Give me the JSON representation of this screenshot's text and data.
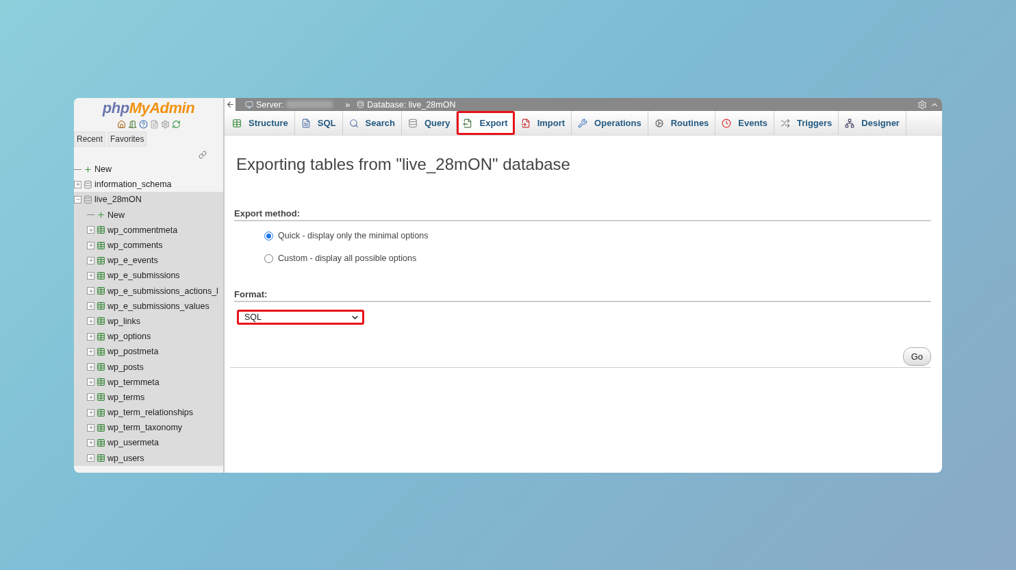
{
  "sidebar": {
    "logo": {
      "prefix": "php",
      "name": "MyAdmin"
    },
    "nav_buttons": [
      {
        "label": "Recent"
      },
      {
        "label": "Favorites"
      }
    ],
    "tree": [
      {
        "label": "New",
        "kind": "new"
      },
      {
        "label": "information_schema",
        "kind": "database",
        "expanded": false,
        "selected": false
      },
      {
        "label": "live_28mON",
        "kind": "database",
        "expanded": true,
        "selected": true,
        "children": [
          {
            "label": "New",
            "kind": "new"
          },
          {
            "label": "wp_commentmeta",
            "kind": "table",
            "expanded": false
          },
          {
            "label": "wp_comments",
            "kind": "table",
            "expanded": false
          },
          {
            "label": "wp_e_events",
            "kind": "table",
            "expanded": false
          },
          {
            "label": "wp_e_submissions",
            "kind": "table",
            "expanded": false
          },
          {
            "label": "wp_e_submissions_actions_l",
            "kind": "table",
            "expanded": false
          },
          {
            "label": "wp_e_submissions_values",
            "kind": "table",
            "expanded": false
          },
          {
            "label": "wp_links",
            "kind": "table",
            "expanded": false
          },
          {
            "label": "wp_options",
            "kind": "table",
            "expanded": false
          },
          {
            "label": "wp_postmeta",
            "kind": "table",
            "expanded": false
          },
          {
            "label": "wp_posts",
            "kind": "table",
            "expanded": false
          },
          {
            "label": "wp_termmeta",
            "kind": "table",
            "expanded": false
          },
          {
            "label": "wp_terms",
            "kind": "table",
            "expanded": false
          },
          {
            "label": "wp_term_relationships",
            "kind": "table",
            "expanded": false
          },
          {
            "label": "wp_term_taxonomy",
            "kind": "table",
            "expanded": false
          },
          {
            "label": "wp_usermeta",
            "kind": "table",
            "expanded": false
          },
          {
            "label": "wp_users",
            "kind": "table",
            "expanded": false
          }
        ]
      }
    ]
  },
  "breadcrumb": {
    "server_label": "Server:",
    "separator": "»",
    "database": "Database: live_28mON"
  },
  "tabs": [
    {
      "label": "Structure",
      "selected": false,
      "highlighted": false
    },
    {
      "label": "SQL",
      "selected": false,
      "highlighted": false
    },
    {
      "label": "Search",
      "selected": false,
      "highlighted": false
    },
    {
      "label": "Query",
      "selected": false,
      "highlighted": false
    },
    {
      "label": "Export",
      "selected": true,
      "highlighted": true
    },
    {
      "label": "Import",
      "selected": false,
      "highlighted": false
    },
    {
      "label": "Operations",
      "selected": false,
      "highlighted": false
    },
    {
      "label": "Routines",
      "selected": false,
      "highlighted": false
    },
    {
      "label": "Events",
      "selected": false,
      "highlighted": false
    },
    {
      "label": "Triggers",
      "selected": false,
      "highlighted": false
    },
    {
      "label": "Designer",
      "selected": false,
      "highlighted": false
    }
  ],
  "page_title": "Exporting tables from \"live_28mON\" database",
  "export_method": {
    "legend": "Export method:",
    "options": [
      {
        "label": "Quick - display only the minimal options",
        "selected": true
      },
      {
        "label": "Custom - display all possible options",
        "selected": false
      }
    ]
  },
  "format": {
    "legend": "Format:",
    "value": "SQL",
    "highlighted": true
  },
  "go_button": "Go"
}
